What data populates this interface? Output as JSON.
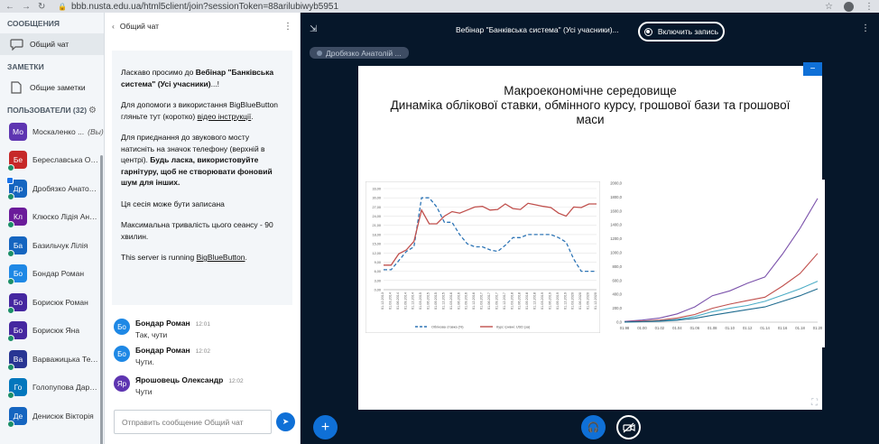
{
  "browser": {
    "url": "bbb.nusta.edu.ua/html5client/join?sessionToken=88arilubiwyb5951"
  },
  "sidebar": {
    "messages_header": "СООБЩЕНИЯ",
    "public_chat_label": "Общий чат",
    "notes_header": "ЗАМЕТКИ",
    "shared_notes_label": "Общие заметки",
    "users_header": "ПОЛЬЗОВАТЕЛИ (32)",
    "users": [
      {
        "initials": "Мо",
        "name": "Москаленко ...",
        "you": "(Вы)",
        "color": "#5e35b1",
        "presenter": false,
        "mic": false
      },
      {
        "initials": "Бе",
        "name": "Береславська Ол...",
        "color": "#c62828",
        "presenter": false,
        "mic": true
      },
      {
        "initials": "Др",
        "name": "Дробязко Анатолі...",
        "color": "#1565c0",
        "presenter": true,
        "mic": true
      },
      {
        "initials": "Кл",
        "name": "Клюско Лідія Анто...",
        "color": "#6a1b9a",
        "presenter": false,
        "mic": true
      },
      {
        "initials": "Ба",
        "name": "Базильчук Лілія",
        "color": "#1565c0",
        "presenter": false,
        "mic": true
      },
      {
        "initials": "Бо",
        "name": "Бондар Роман",
        "color": "#1e88e5",
        "presenter": false,
        "mic": true
      },
      {
        "initials": "Бо",
        "name": "Борисюк Роман",
        "color": "#4527a0",
        "presenter": false,
        "mic": true
      },
      {
        "initials": "Бо",
        "name": "Борисюк Яна",
        "color": "#4527a0",
        "presenter": false,
        "mic": true
      },
      {
        "initials": "Ва",
        "name": "Варважицька Тет...",
        "color": "#283593",
        "presenter": false,
        "mic": true
      },
      {
        "initials": "Го",
        "name": "Голопупова Дарина",
        "color": "#0277bd",
        "presenter": false,
        "mic": true
      },
      {
        "initials": "Де",
        "name": "Денисюк Вікторія",
        "color": "#1565c0",
        "presenter": false,
        "mic": true
      }
    ]
  },
  "chat": {
    "title": "Общий чат",
    "welcome": {
      "p1_pre": "Ласкаво просимо до ",
      "p1_bold": "Вебінар \"Банківська система\" (Усі учасники)",
      "p1_post": "...!",
      "p2_pre": "Для допомоги з використання BigBlueButton гляньте тут (коротко) ",
      "p2_link": "відео інструкції",
      "p2_post": ".",
      "p3_pre": "Для приєднання до звукового мосту натисніть на значок телефону (верхній в центрі). ",
      "p3_bold": "Будь ласка, використовуйте гарнітуру, щоб не створювати фоновий шум для інших.",
      "p4": "Ця сесія може бути записана",
      "p5": "Максимальна тривалість цього сеансу - 90 хвилин.",
      "p6_pre": "This server is running ",
      "p6_link": "BigBlueButton",
      "p6_post": "."
    },
    "messages": [
      {
        "initials": "Бо",
        "name": "Бондар Роман",
        "time": "12:01",
        "text": "Так, чути",
        "color": "#1e88e5"
      },
      {
        "initials": "Бо",
        "name": "Бондар Роман",
        "time": "12:02",
        "text": "Чути.",
        "color": "#1e88e5"
      },
      {
        "initials": "Яр",
        "name": "Ярошовець Олександр",
        "time": "12:02",
        "text": "Чути",
        "color": "#5e35b1"
      }
    ],
    "input_placeholder": "Отправить сообщение Общий чат"
  },
  "main": {
    "meeting_title": "Вебінар \"Банківська система\" (Усі учасники)...",
    "record_label": "Включить запись",
    "talker": "Дробязко Анатолій ...",
    "slide": {
      "title_line1": "Макроекономічне середовище",
      "title_line2": "Динаміка облікової ставки, обмінного курсу, грошової бази та грошової",
      "title_line3": "маси"
    }
  },
  "chart_data": [
    {
      "type": "line",
      "x": [
        "01.12.2013",
        "01.03.2014",
        "01.06.2014",
        "01.09.2014",
        "01.12.2014",
        "01.03.2015",
        "01.06.2015",
        "01.09.2015",
        "01.12.2015",
        "01.03.2016",
        "01.06.2016",
        "01.09.2016",
        "01.12.2016",
        "01.03.2017",
        "01.06.2017",
        "01.09.2017",
        "01.12.2017",
        "01.03.2018",
        "01.06.2018",
        "01.09.2018",
        "01.12.2018",
        "01.03.2019",
        "01.06.2019",
        "01.09.2019",
        "01.12.2019",
        "01.03.2020",
        "01.06.2020",
        "01.09.2020",
        "01.12.2020"
      ],
      "series": [
        {
          "name": "Облікова ставка (%)",
          "color": "#2e75b6",
          "dashed": true,
          "values": [
            6.5,
            6.5,
            9.5,
            12.5,
            14,
            30,
            30,
            27,
            22,
            22,
            18,
            15,
            14,
            14,
            13,
            12.5,
            14.5,
            17,
            17,
            18,
            18,
            18,
            18,
            17,
            15.5,
            10,
            6,
            6,
            6
          ]
        },
        {
          "name": "Курс гривні: USD (за)",
          "color": "#c0504d",
          "dashed": false,
          "values": [
            8,
            8,
            11.7,
            13,
            15.8,
            26,
            21.5,
            21.5,
            24,
            25.5,
            25,
            26,
            27,
            27.2,
            26,
            26.2,
            28,
            26.5,
            26.2,
            28.2,
            27.7,
            27.2,
            26.8,
            25,
            24,
            27,
            26.8,
            28,
            28
          ]
        }
      ],
      "yticks": [
        "33,00",
        "30,00",
        "27,00",
        "24,00",
        "21,00",
        "18,00",
        "15,00",
        "12,00",
        "9,00",
        "6,00",
        "3,00",
        "0,00"
      ],
      "ylim": [
        0,
        33
      ]
    },
    {
      "type": "line",
      "x": [
        "01.98",
        "01.00",
        "01.02",
        "01.04",
        "01.06",
        "01.08",
        "01.10",
        "01.12",
        "01.14",
        "01.16",
        "01.18",
        "01.20"
      ],
      "series": [
        {
          "name": "",
          "color": "#7b52ab",
          "values": [
            10,
            30,
            60,
            120,
            220,
            380,
            450,
            560,
            650,
            980,
            1350,
            1780
          ]
        },
        {
          "name": "",
          "color": "#c0504d",
          "values": [
            5,
            15,
            30,
            60,
            110,
            200,
            260,
            310,
            360,
            520,
            700,
            990
          ]
        },
        {
          "name": "",
          "color": "#4bacc6",
          "values": [
            3,
            8,
            20,
            40,
            80,
            150,
            200,
            240,
            300,
            390,
            480,
            590
          ]
        },
        {
          "name": "",
          "color": "#1f6b8f",
          "values": [
            2,
            6,
            14,
            28,
            55,
            100,
            140,
            180,
            220,
            300,
            380,
            480
          ]
        }
      ],
      "yticks": [
        "2000,0",
        "1800,0",
        "1600,0",
        "1400,0",
        "1200,0",
        "1000,0",
        "800,0",
        "600,0",
        "400,0",
        "200,0",
        "0,0"
      ],
      "ylim": [
        0,
        2000
      ]
    }
  ]
}
